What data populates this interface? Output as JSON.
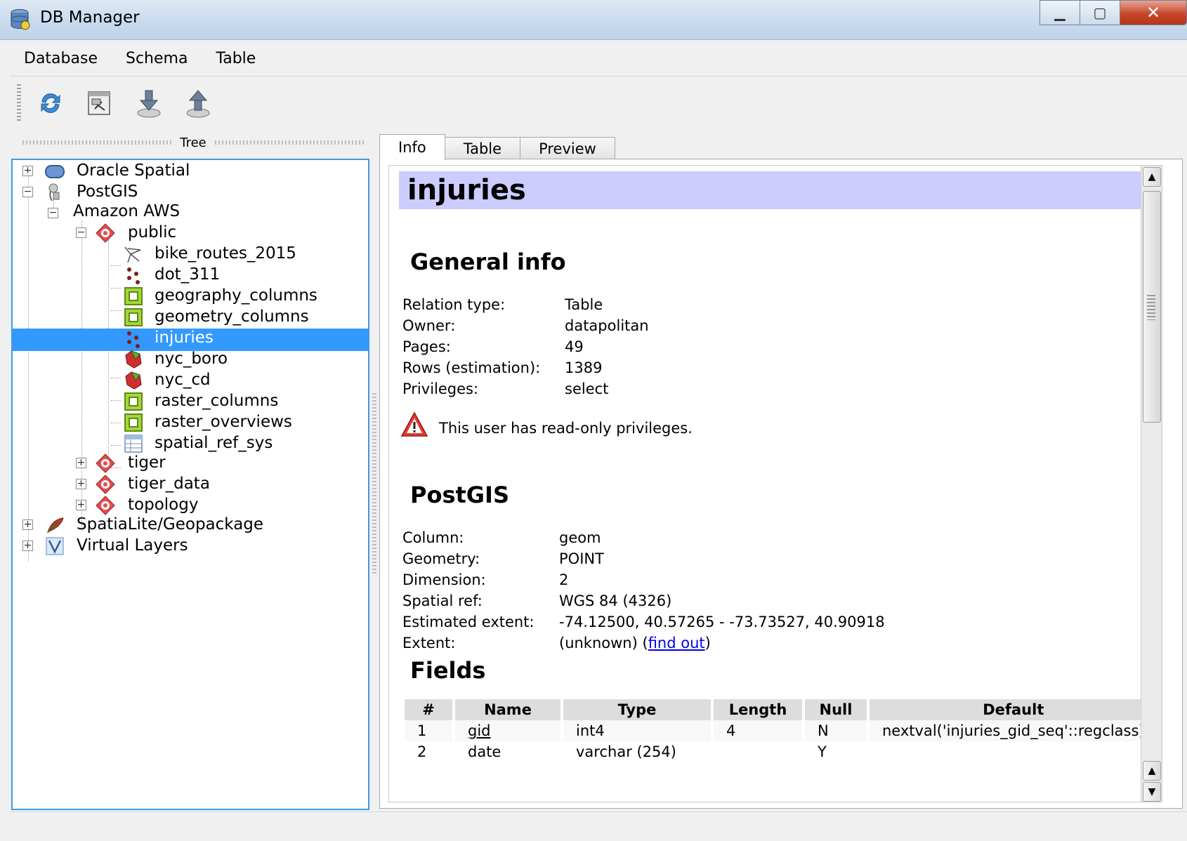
{
  "window": {
    "title": "DB Manager"
  },
  "menu": {
    "items": [
      "Database",
      "Schema",
      "Table"
    ]
  },
  "toolbar": {
    "buttons": [
      {
        "name": "refresh-icon"
      },
      {
        "name": "sql-window-icon"
      },
      {
        "name": "import-layer-icon"
      },
      {
        "name": "export-file-icon"
      }
    ]
  },
  "tree": {
    "title": "Tree",
    "nodes": {
      "oracle": "Oracle Spatial",
      "postgis": "PostGIS",
      "aws": "Amazon AWS",
      "public": "public",
      "bike_routes": "bike_routes_2015",
      "dot_311": "dot_311",
      "geography_columns": "geography_columns",
      "geometry_columns": "geometry_columns",
      "injuries": "injuries",
      "nyc_boro": "nyc_boro",
      "nyc_cd": "nyc_cd",
      "raster_columns": "raster_columns",
      "raster_overviews": "raster_overviews",
      "spatial_ref_sys": "spatial_ref_sys",
      "tiger": "tiger",
      "tiger_data": "tiger_data",
      "topology": "topology",
      "spatialite": "SpatiaLite/Geopackage",
      "virtual": "Virtual Layers"
    }
  },
  "tabs": [
    "Info",
    "Table",
    "Preview"
  ],
  "info": {
    "title": "injuries",
    "general": {
      "heading": "General info",
      "labels": [
        "Relation type:",
        "Owner:",
        "Pages:",
        "Rows (estimation):",
        "Privileges:"
      ],
      "values": [
        "Table",
        "datapolitan",
        "49",
        "1389",
        "select"
      ],
      "warning": "This user has read-only privileges."
    },
    "postgis": {
      "heading": "PostGIS",
      "labels": [
        "Column:",
        "Geometry:",
        "Dimension:",
        "Spatial ref:",
        "Estimated extent:",
        "Extent:"
      ],
      "values": [
        "geom",
        "POINT",
        "2",
        "WGS 84 (4326)",
        "-74.12500, 40.57265 - -73.73527, 40.90918",
        "(unknown) ("
      ],
      "find_out": "find out",
      "extent_close": ")"
    },
    "fields": {
      "heading": "Fields",
      "columns": [
        "#",
        "Name",
        "Type",
        "Length",
        "Null",
        "Default"
      ],
      "rows": [
        [
          "1",
          "gid",
          "int4",
          "4",
          "N",
          "nextval('injuries_gid_seq'::regclass)"
        ],
        [
          "2",
          "date",
          "varchar (254)",
          "",
          "Y",
          ""
        ]
      ]
    }
  },
  "colors": {
    "selection": "#3399ff",
    "title_band": "#ccccff",
    "tree_border": "#3c9ae8"
  }
}
